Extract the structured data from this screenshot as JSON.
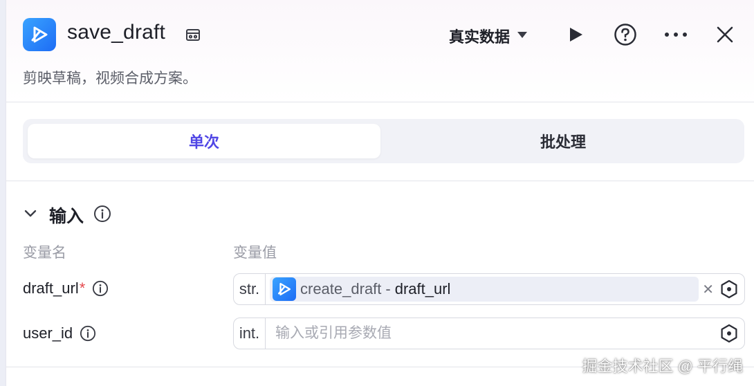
{
  "header": {
    "title": "save_draft",
    "description": "剪映草稿，视频合成方案。",
    "data_mode": "真实数据"
  },
  "tabs": [
    {
      "label": "单次",
      "active": true
    },
    {
      "label": "批处理",
      "active": false
    }
  ],
  "inputs": {
    "section_title": "输入",
    "col_name_label": "变量名",
    "col_value_label": "变量值",
    "rows": [
      {
        "name": "draft_url",
        "required_mark": "*",
        "type": "str.",
        "ref_source": "create_draft",
        "ref_separator": "-",
        "ref_key": "draft_url"
      },
      {
        "name": "user_id",
        "type": "int.",
        "placeholder": "输入或引用参数值"
      }
    ]
  },
  "watermark": "掘金技术社区 @ 平行绳",
  "colors": {
    "accent": "#5046e5",
    "brand_blue": "#1d6cf5",
    "required": "#e5484d"
  },
  "icons": [
    "app-logo-icon",
    "store-icon",
    "caret-down-icon",
    "play-icon",
    "help-icon",
    "more-icon",
    "close-icon",
    "chevron-down-icon",
    "info-icon",
    "clear-icon",
    "variable-ref-icon"
  ]
}
